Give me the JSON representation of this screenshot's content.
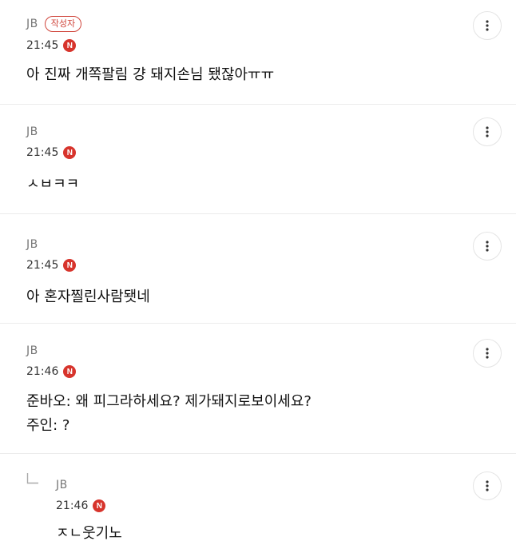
{
  "comments": [
    {
      "author": "JB",
      "badge": "작성자",
      "time": "21:45",
      "new_badge": "N",
      "body": [
        "아 진짜 개쪽팔림 걍 돼지손님 됐잖아ㅠㅠ"
      ]
    },
    {
      "author": "JB",
      "time": "21:45",
      "new_badge": "N",
      "body": [
        "ㅅㅂㅋㅋ"
      ]
    },
    {
      "author": "JB",
      "time": "21:45",
      "new_badge": "N",
      "body": [
        "아 혼자찔린사람됏네"
      ]
    },
    {
      "author": "JB",
      "time": "21:46",
      "new_badge": "N",
      "body": [
        "준바오: 왜 피그라하세요? 제가돼지로보이세요?",
        "주인: ?"
      ]
    },
    {
      "author": "JB",
      "time": "21:46",
      "new_badge": "N",
      "is_reply": true,
      "body": [
        "ㅈㄴ웃기노"
      ]
    }
  ],
  "icons": {
    "menu": "more-vertical-icon",
    "reply": "reply-arrow-icon"
  },
  "colors": {
    "accent": "#d7342c",
    "badge_border": "#d0453b",
    "divider": "#ececec"
  }
}
